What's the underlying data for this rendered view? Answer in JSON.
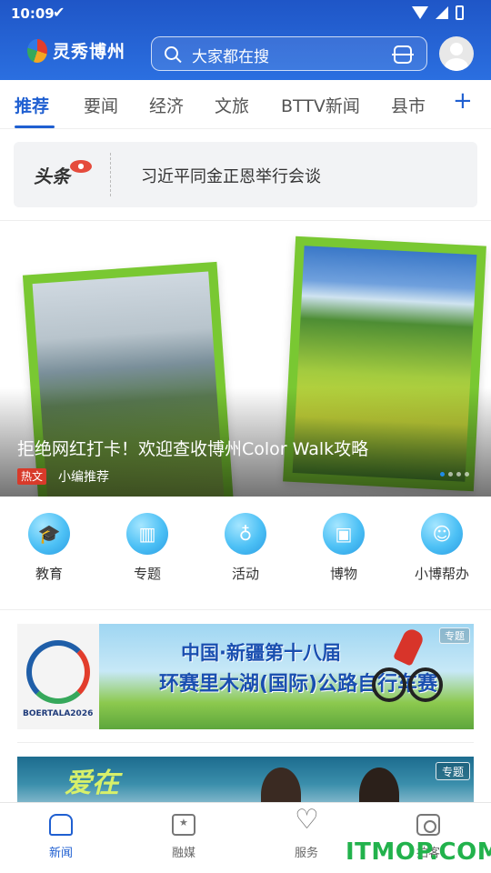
{
  "status_bar": {
    "time": "10:09"
  },
  "header": {
    "app_name": "灵秀博州",
    "search_placeholder": "大家都在搜"
  },
  "tabs": [
    {
      "label": "推荐",
      "active": true
    },
    {
      "label": "要闻"
    },
    {
      "label": "经济"
    },
    {
      "label": "文旅"
    },
    {
      "label": "BTTV新闻"
    },
    {
      "label": "县市"
    }
  ],
  "headline": {
    "brand": "头条",
    "text": "习近平同金正恩举行会谈"
  },
  "carousel": {
    "title": "拒绝网红打卡！欢迎查收博州Color Walk攻略",
    "tag": "热文",
    "source": "小编推荐"
  },
  "shortcuts": [
    {
      "label": "教育",
      "icon": "education-icon"
    },
    {
      "label": "专题",
      "icon": "book-icon"
    },
    {
      "label": "活动",
      "icon": "balloon-icon"
    },
    {
      "label": "博物",
      "icon": "gift-icon"
    },
    {
      "label": "小博帮办",
      "icon": "helper-icon"
    }
  ],
  "promo1": {
    "logo_text": "BOERTALA2026",
    "line1": "中国·新疆第十八届",
    "line2": "环赛里木湖(国际)公路自行车赛",
    "tag": "专题"
  },
  "promo2": {
    "text": "爱在",
    "tag": "专题"
  },
  "bottom_nav": [
    {
      "label": "新闻",
      "active": true
    },
    {
      "label": "融媒"
    },
    {
      "label": "服务"
    },
    {
      "label": "拍客"
    }
  ],
  "watermark": "ITMOP.COM",
  "colors": {
    "primary": "#1f5fd1",
    "header": "#2b6fe0",
    "tag_red": "#d83a2a",
    "frame_green": "#79c832"
  }
}
